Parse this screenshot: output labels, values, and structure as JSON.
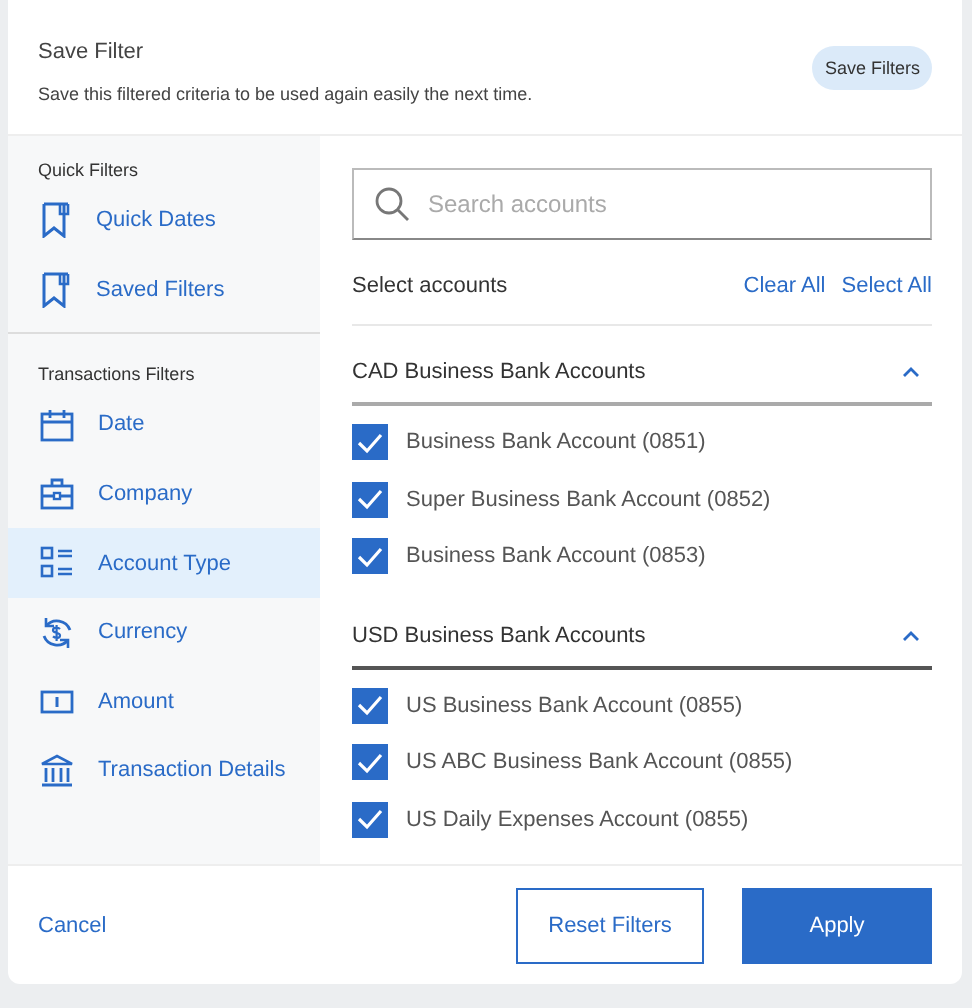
{
  "header": {
    "title": "Save Filter",
    "subtitle": "Save this filtered criteria to be used again easily the next time.",
    "save_button": "Save Filters"
  },
  "sidebar": {
    "groups": [
      {
        "heading": "Quick Filters",
        "items": [
          {
            "label": "Quick Dates",
            "kind": "bookmark",
            "selected": false
          },
          {
            "label": "Saved Filters",
            "kind": "bookmark",
            "selected": false
          }
        ]
      },
      {
        "heading": "Transactions Filters",
        "items": [
          {
            "label": "Date",
            "kind": "calendar",
            "selected": false
          },
          {
            "label": "Company",
            "kind": "briefcase",
            "selected": false
          },
          {
            "label": "Account Type",
            "kind": "list",
            "selected": true
          },
          {
            "label": "Currency",
            "kind": "currency",
            "selected": false
          },
          {
            "label": "Amount",
            "kind": "banknote",
            "selected": false
          },
          {
            "label": "Transaction Details",
            "kind": "bank",
            "selected": false
          }
        ]
      }
    ]
  },
  "search": {
    "placeholder": "Search accounts"
  },
  "select_label": "Select accounts",
  "clear_all": "Clear All",
  "select_all": "Select All",
  "sections": [
    {
      "title": "CAD Business Bank Accounts",
      "expanded": true,
      "accounts": [
        {
          "label": "Business Bank Account (0851)",
          "checked": true
        },
        {
          "label": "Super Business Bank Account (0852)",
          "checked": true
        },
        {
          "label": "Business Bank Account (0853)",
          "checked": true
        }
      ]
    },
    {
      "title": "USD Business Bank Accounts",
      "expanded": true,
      "accounts": [
        {
          "label": "US Business Bank Account (0855)",
          "checked": true
        },
        {
          "label": "US ABC Business Bank Account (0855)",
          "checked": true
        },
        {
          "label": "US Daily Expenses Account (0855)",
          "checked": true
        }
      ]
    }
  ],
  "footer": {
    "cancel": "Cancel",
    "reset": "Reset Filters",
    "apply": "Apply"
  }
}
